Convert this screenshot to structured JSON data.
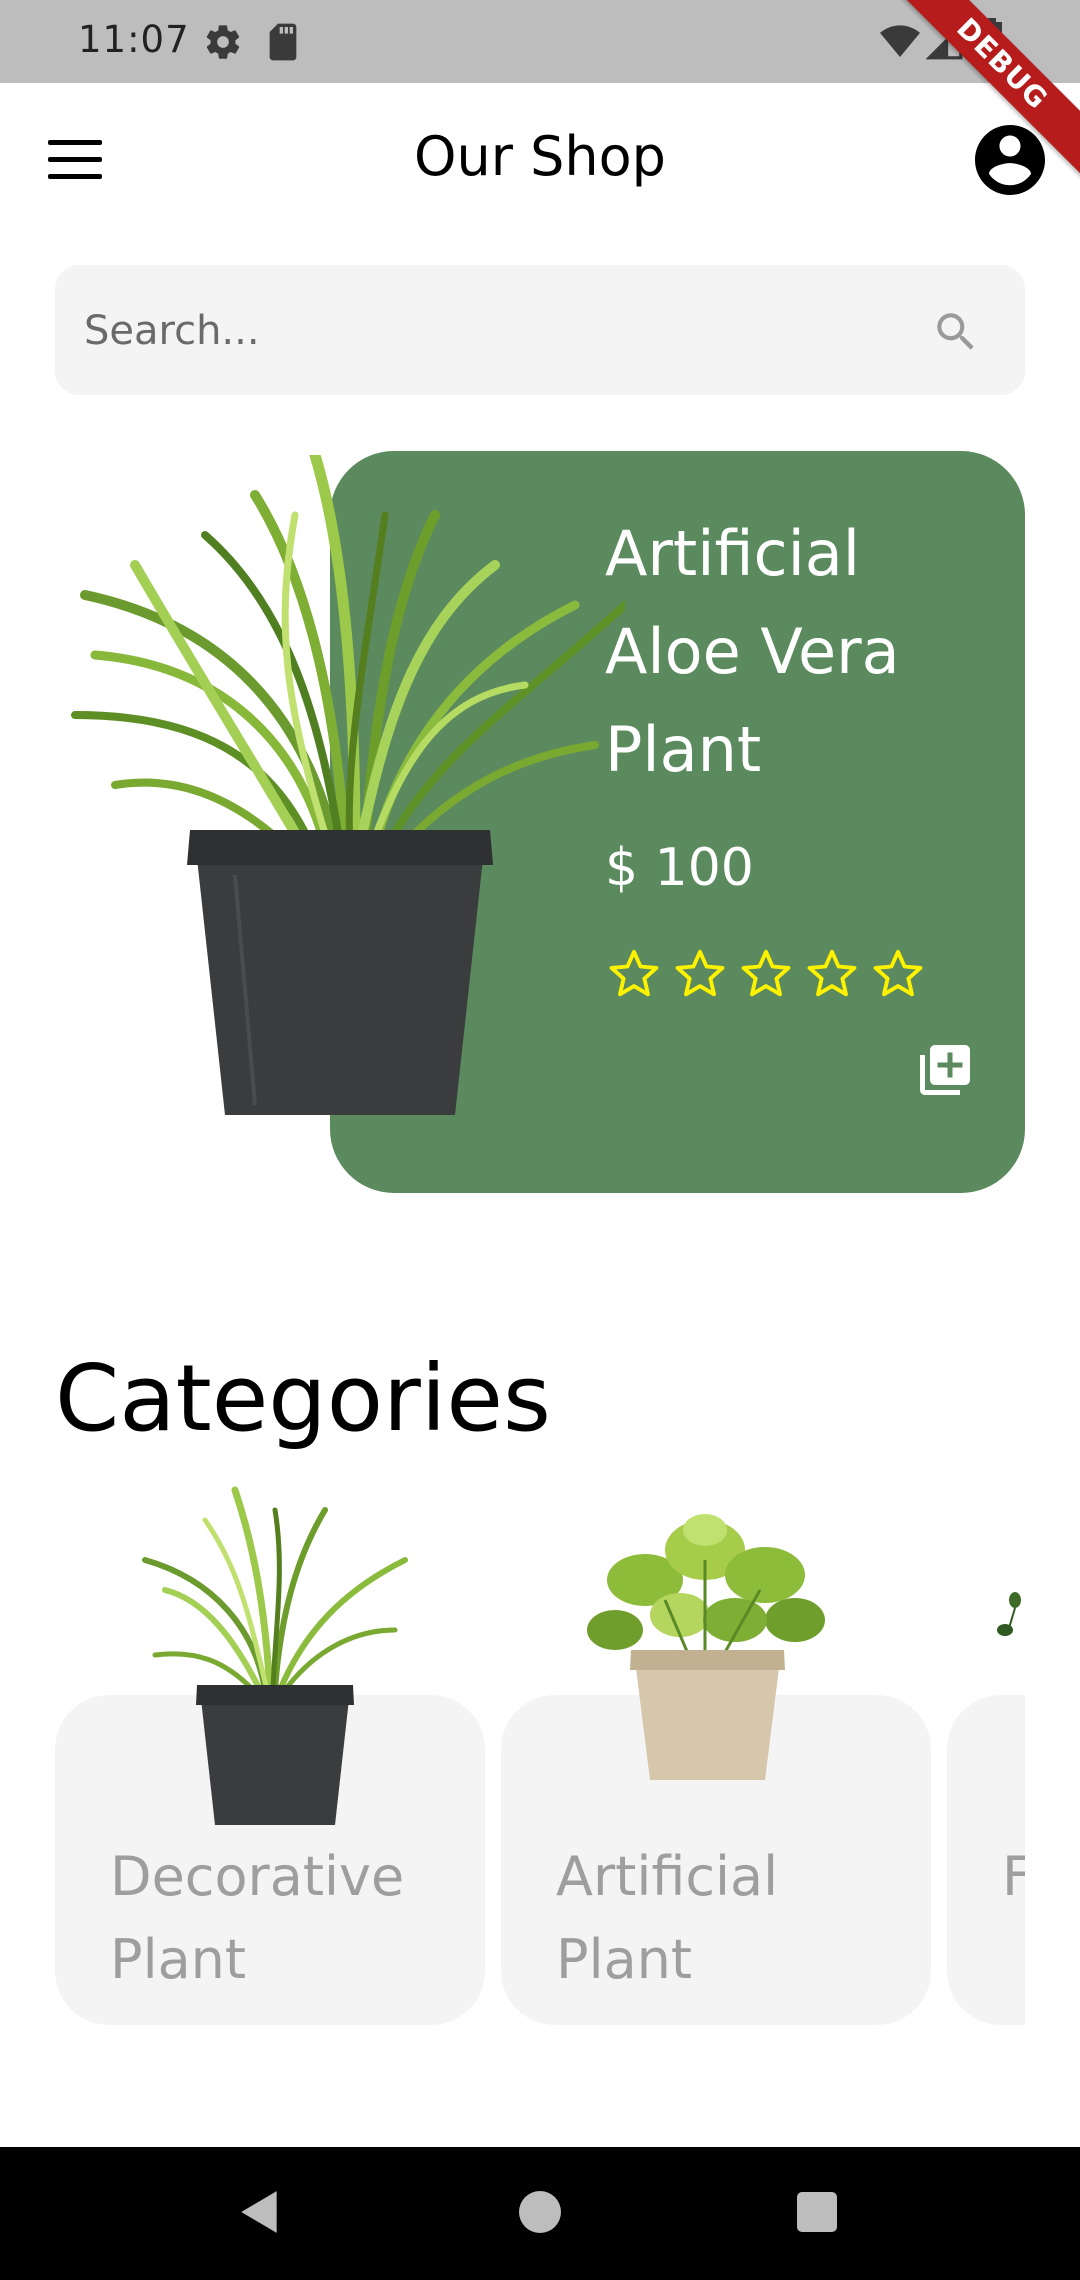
{
  "status_bar": {
    "time": "11:07",
    "icons": [
      "gear-icon",
      "sd-card-icon",
      "wifi-icon",
      "signal-icon",
      "battery-icon"
    ]
  },
  "debug_banner": "DEBUG",
  "app_bar": {
    "title": "Our Shop",
    "menu_icon": "hamburger-menu-icon",
    "account_icon": "account-circle-icon"
  },
  "search": {
    "placeholder": "Search...",
    "icon": "search-icon"
  },
  "featured": {
    "title": "Artificial Aloe Vera Plant",
    "price": "$ 100",
    "rating_stars": 5,
    "rating_filled": 0,
    "add_icon": "library-add-icon",
    "card_color": "#5a8a5e",
    "star_color": "#fff200"
  },
  "categories": {
    "title": "Categories",
    "items": [
      {
        "label": "Decorative Plant"
      },
      {
        "label": "Artificial Plant"
      },
      {
        "label": "F P"
      }
    ]
  },
  "nav_bar": {
    "icons": [
      "back-icon",
      "home-icon",
      "recents-icon"
    ]
  }
}
